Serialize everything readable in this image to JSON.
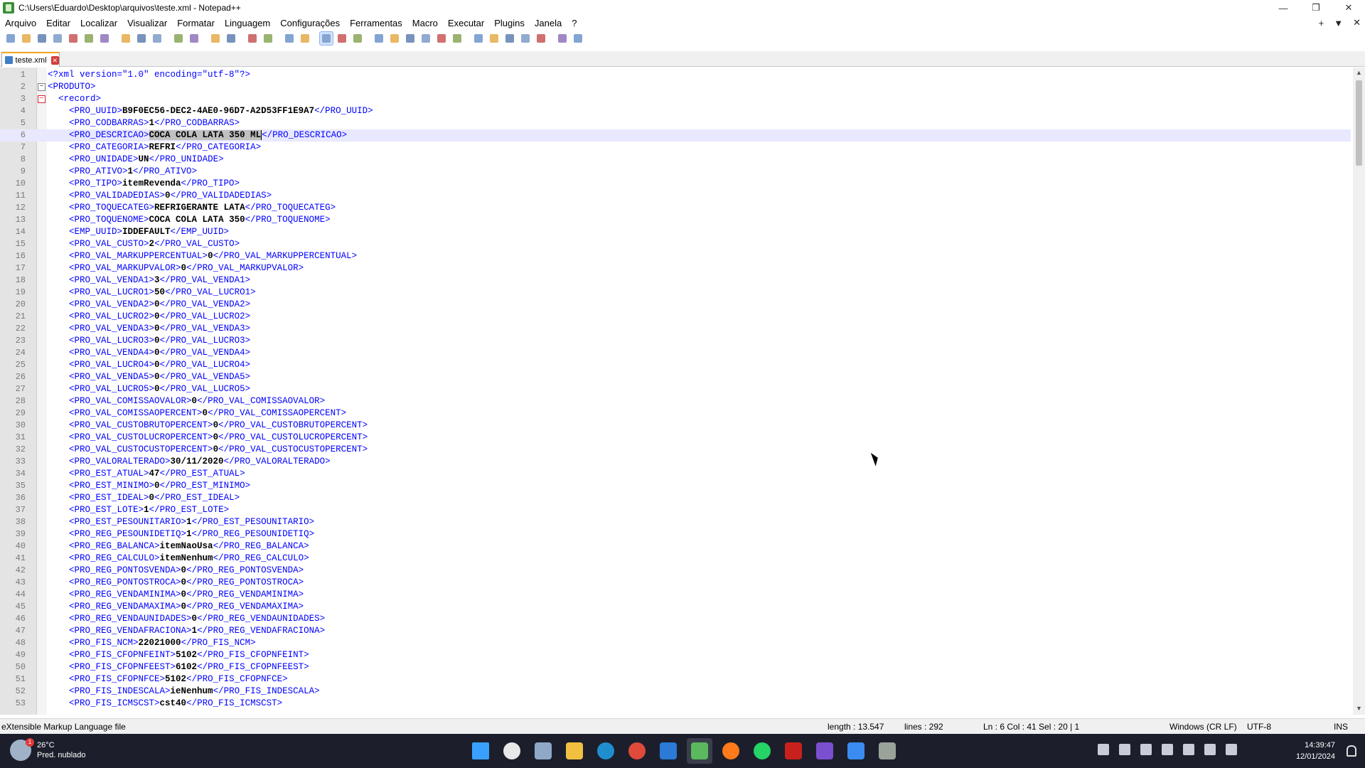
{
  "window": {
    "title": "C:\\Users\\Eduardo\\Desktop\\arquivos\\teste.xml - Notepad++",
    "controls": [
      "—",
      "❐",
      "✕"
    ]
  },
  "menu": {
    "items": [
      "Arquivo",
      "Editar",
      "Localizar",
      "Visualizar",
      "Formatar",
      "Linguagem",
      "Configurações",
      "Ferramentas",
      "Macro",
      "Executar",
      "Plugins",
      "Janela",
      "?"
    ],
    "right_controls": [
      "+",
      "▼",
      "✕"
    ]
  },
  "toolbar": {
    "icons": [
      "new-file-icon",
      "open-file-icon",
      "save-icon",
      "save-all-icon",
      "close-icon",
      "close-all-icon",
      "print-icon",
      "sep",
      "cut-icon",
      "copy-icon",
      "paste-icon",
      "sep",
      "undo-icon",
      "redo-icon",
      "sep",
      "find-icon",
      "replace-icon",
      "sep",
      "zoom-in-icon",
      "zoom-out-icon",
      "sep",
      "sync-v-icon",
      "sync-h-icon",
      "sep",
      "word-wrap-icon",
      "show-all-chars-icon",
      "indent-guide-icon",
      "sep",
      "udl-icon",
      "doc-map-icon",
      "function-list-icon",
      "folder-workspace-icon",
      "doc-list-icon",
      "monitor-icon",
      "sep",
      "record-macro-icon",
      "stop-macro-icon",
      "play-macro-icon",
      "run-macro-multiple-icon",
      "save-macro-icon",
      "sep",
      "spellcheck-icon",
      "binoculars-icon"
    ]
  },
  "tabs": [
    {
      "label": "teste.xml",
      "active": true
    }
  ],
  "editor": {
    "current_line": 6,
    "lines": [
      {
        "n": "1",
        "kind": "decl",
        "text": "<?xml version=\"1.0\" encoding=\"utf-8\"?>"
      },
      {
        "n": "2",
        "kind": "open",
        "text": "<PRODUTO>"
      },
      {
        "n": "3",
        "kind": "open2",
        "text": "  <record>"
      },
      {
        "n": "4",
        "tag": "PRO_UUID",
        "val": "B9F0EC56-DEC2-4AE0-96D7-A2D53FF1E9A7"
      },
      {
        "n": "5",
        "tag": "PRO_CODBARRAS",
        "val": "1"
      },
      {
        "n": "6",
        "tag": "PRO_DESCRICAO",
        "val": "COCA COLA LATA 350 ML",
        "selected": true
      },
      {
        "n": "7",
        "tag": "PRO_CATEGORIA",
        "val": "REFRI"
      },
      {
        "n": "8",
        "tag": "PRO_UNIDADE",
        "val": "UN"
      },
      {
        "n": "9",
        "tag": "PRO_ATIVO",
        "val": "1"
      },
      {
        "n": "10",
        "tag": "PRO_TIPO",
        "val": "itemRevenda"
      },
      {
        "n": "11",
        "tag": "PRO_VALIDADEDIAS",
        "val": "0"
      },
      {
        "n": "12",
        "tag": "PRO_TOQUECATEG",
        "val": "REFRIGERANTE LATA"
      },
      {
        "n": "13",
        "tag": "PRO_TOQUENOME",
        "val": "COCA COLA LATA 350"
      },
      {
        "n": "14",
        "tag": "EMP_UUID",
        "val": "IDDEFAULT"
      },
      {
        "n": "15",
        "tag": "PRO_VAL_CUSTO",
        "val": "2"
      },
      {
        "n": "16",
        "tag": "PRO_VAL_MARKUPPERCENTUAL",
        "val": "0"
      },
      {
        "n": "17",
        "tag": "PRO_VAL_MARKUPVALOR",
        "val": "0"
      },
      {
        "n": "18",
        "tag": "PRO_VAL_VENDA1",
        "val": "3"
      },
      {
        "n": "19",
        "tag": "PRO_VAL_LUCRO1",
        "val": "50"
      },
      {
        "n": "20",
        "tag": "PRO_VAL_VENDA2",
        "val": "0"
      },
      {
        "n": "21",
        "tag": "PRO_VAL_LUCRO2",
        "val": "0"
      },
      {
        "n": "22",
        "tag": "PRO_VAL_VENDA3",
        "val": "0"
      },
      {
        "n": "23",
        "tag": "PRO_VAL_LUCRO3",
        "val": "0"
      },
      {
        "n": "24",
        "tag": "PRO_VAL_VENDA4",
        "val": "0"
      },
      {
        "n": "25",
        "tag": "PRO_VAL_LUCRO4",
        "val": "0"
      },
      {
        "n": "26",
        "tag": "PRO_VAL_VENDA5",
        "val": "0"
      },
      {
        "n": "27",
        "tag": "PRO_VAL_LUCRO5",
        "val": "0"
      },
      {
        "n": "28",
        "tag": "PRO_VAL_COMISSAOVALOR",
        "val": "0"
      },
      {
        "n": "29",
        "tag": "PRO_VAL_COMISSAOPERCENT",
        "val": "0"
      },
      {
        "n": "30",
        "tag": "PRO_VAL_CUSTOBRUTOPERCENT",
        "val": "0"
      },
      {
        "n": "31",
        "tag": "PRO_VAL_CUSTOLUCROPERCENT",
        "val": "0"
      },
      {
        "n": "32",
        "tag": "PRO_VAL_CUSTOCUSTOPERCENT",
        "val": "0"
      },
      {
        "n": "33",
        "tag": "PRO_VALORALTERADO",
        "val": "30/11/2020"
      },
      {
        "n": "34",
        "tag": "PRO_EST_ATUAL",
        "val": "47"
      },
      {
        "n": "35",
        "tag": "PRO_EST_MINIMO",
        "val": "0"
      },
      {
        "n": "36",
        "tag": "PRO_EST_IDEAL",
        "val": "0"
      },
      {
        "n": "37",
        "tag": "PRO_EST_LOTE",
        "val": "1"
      },
      {
        "n": "38",
        "tag": "PRO_EST_PESOUNITARIO",
        "val": "1"
      },
      {
        "n": "39",
        "tag": "PRO_REG_PESOUNIDETIQ",
        "val": "1"
      },
      {
        "n": "40",
        "tag": "PRO_REG_BALANCA",
        "val": "itemNaoUsa"
      },
      {
        "n": "41",
        "tag": "PRO_REG_CALCULO",
        "val": "itemNenhum"
      },
      {
        "n": "42",
        "tag": "PRO_REG_PONTOSVENDA",
        "val": "0"
      },
      {
        "n": "43",
        "tag": "PRO_REG_PONTOSTROCA",
        "val": "0"
      },
      {
        "n": "44",
        "tag": "PRO_REG_VENDAMINIMA",
        "val": "0"
      },
      {
        "n": "45",
        "tag": "PRO_REG_VENDAMAXIMA",
        "val": "0"
      },
      {
        "n": "46",
        "tag": "PRO_REG_VENDAUNIDADES",
        "val": "0"
      },
      {
        "n": "47",
        "tag": "PRO_REG_VENDAFRACIONA",
        "val": "1"
      },
      {
        "n": "48",
        "tag": "PRO_FIS_NCM",
        "val": "22021000"
      },
      {
        "n": "49",
        "tag": "PRO_FIS_CFOPNFEINT",
        "val": "5102"
      },
      {
        "n": "50",
        "tag": "PRO_FIS_CFOPNFEEST",
        "val": "6102"
      },
      {
        "n": "51",
        "tag": "PRO_FIS_CFOPNFCE",
        "val": "5102"
      },
      {
        "n": "52",
        "tag": "PRO_FIS_INDESCALA",
        "val": "ieNenhum"
      },
      {
        "n": "53",
        "tag": "PRO_FIS_ICMSCST",
        "val": "cst40"
      }
    ]
  },
  "statusbar": {
    "file_type": "eXtensible Markup Language file",
    "length": "length : 13.547",
    "lines": "lines : 292",
    "position": "Ln : 6    Col : 41    Sel : 20 | 1",
    "eol": "Windows (CR LF)",
    "encoding": "UTF-8",
    "mode": "INS"
  },
  "taskbar": {
    "weather_temp": "26°C",
    "weather_desc": "Pred. nublado",
    "weather_badge": "1",
    "time": "14:39:47",
    "date": "12/01/2024",
    "apps": [
      {
        "name": "windows-start",
        "color": "#3aa0ff"
      },
      {
        "name": "chat-app",
        "color": "#e8e8e8"
      },
      {
        "name": "settings",
        "color": "#8fa8c8"
      },
      {
        "name": "file-explorer",
        "color": "#f2c041"
      },
      {
        "name": "edge-browser",
        "color": "#1f8ecf"
      },
      {
        "name": "chrome-browser",
        "color": "#e04a3a"
      },
      {
        "name": "mail",
        "color": "#2a7ad6"
      },
      {
        "name": "notepad-plus-plus",
        "color": "#5cb85c"
      },
      {
        "name": "firefox-browser",
        "color": "#ff7a1a"
      },
      {
        "name": "whatsapp",
        "color": "#25d366"
      },
      {
        "name": "filezilla",
        "color": "#c8211d"
      },
      {
        "name": "media-app",
        "color": "#7a4fd0"
      },
      {
        "name": "notepad",
        "color": "#3b8cf0"
      },
      {
        "name": "terminal-app",
        "color": "#9aa39a"
      }
    ]
  }
}
